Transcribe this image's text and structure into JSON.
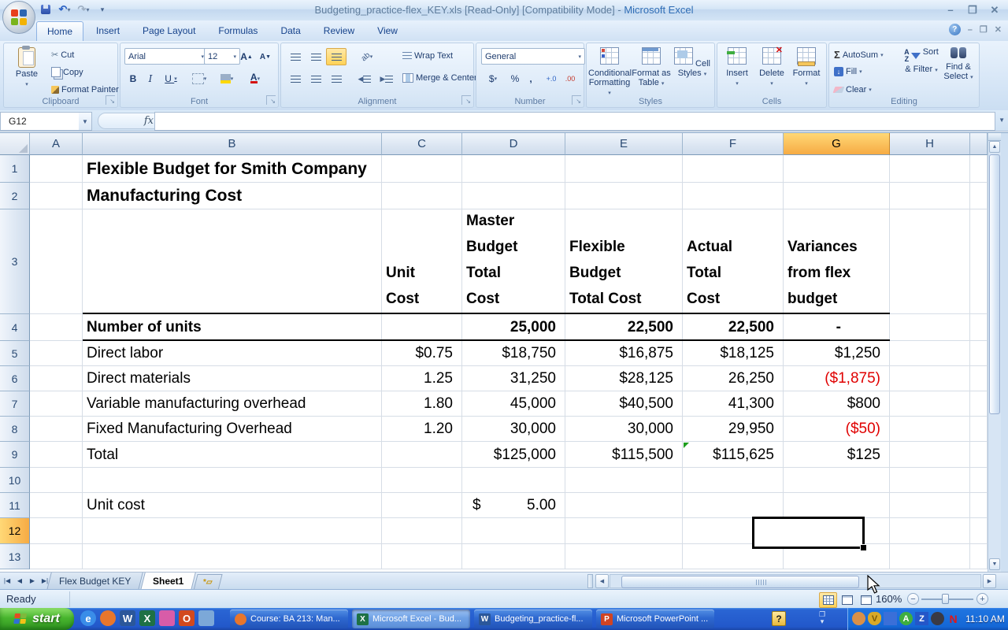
{
  "titlebar": {
    "doc_title": "Budgeting_practice-flex_KEY.xls  [Read-Only]  [Compatibility Mode] - ",
    "app_title": "Microsoft Excel"
  },
  "ribbon": {
    "active_tab": "Home",
    "tabs": [
      "Home",
      "Insert",
      "Page Layout",
      "Formulas",
      "Data",
      "Review",
      "View"
    ],
    "clipboard": {
      "label": "Clipboard",
      "paste": "Paste",
      "cut": "Cut",
      "copy": "Copy",
      "format_painter": "Format Painter"
    },
    "font": {
      "label": "Font",
      "name": "Arial",
      "size": "12",
      "bold": "B",
      "italic": "I",
      "underline": "U"
    },
    "alignment": {
      "label": "Alignment",
      "wrap": "Wrap Text",
      "merge": "Merge & Center"
    },
    "number": {
      "label": "Number",
      "format": "General",
      "currency": "$",
      "percent": "%",
      "comma": ",",
      "inc_dec": "+.0",
      "dec_dec": ".00"
    },
    "styles": {
      "label": "Styles",
      "conditional": "Conditional Formatting",
      "format_table": "Format as Table",
      "cell_styles": "Cell Styles"
    },
    "cells": {
      "label": "Cells",
      "insert": "Insert",
      "delete": "Delete",
      "format": "Format"
    },
    "editing": {
      "label": "Editing",
      "autosum": "AutoSum",
      "fill": "Fill",
      "clear": "Clear",
      "sort_filter": "Sort & Filter",
      "find_select": "Find & Select"
    }
  },
  "formula_bar": {
    "name_box": "G12",
    "fx_label": "fx",
    "formula": ""
  },
  "grid": {
    "col_headers": [
      "A",
      "B",
      "C",
      "D",
      "E",
      "F",
      "G",
      "H"
    ],
    "selected_col": "G",
    "selected_row": 12,
    "selected_cell": "G12",
    "accent_colors": {
      "selection_header": "#f6ab44",
      "negative_value": "#e00000",
      "flag_green": "#1e9e1e"
    },
    "rows": [
      {
        "n": 1,
        "cells": [
          {
            "col": "B",
            "text": "Flexible Budget for Smith Company",
            "bold": true,
            "overflow": true,
            "big": true
          }
        ]
      },
      {
        "n": 2,
        "cells": [
          {
            "col": "B",
            "text": "Manufacturing Cost",
            "bold": true,
            "overflow": true,
            "big": true
          }
        ]
      },
      {
        "n": 3,
        "cells": [
          {
            "col": "C",
            "text": "Unit\nCost",
            "bold": true,
            "multiline": true
          },
          {
            "col": "D",
            "text": "Master\nBudget\nTotal\nCost",
            "bold": true,
            "multiline": true
          },
          {
            "col": "E",
            "text": "Flexible\nBudget\nTotal Cost",
            "bold": true,
            "multiline": true
          },
          {
            "col": "F",
            "text": "Actual\nTotal\nCost",
            "bold": true,
            "multiline": true
          },
          {
            "col": "G",
            "text": "Variances\nfrom flex\nbudget",
            "bold": true,
            "multiline": true
          }
        ]
      },
      {
        "n": 4,
        "cells": [
          {
            "col": "B",
            "text": "Number of units",
            "bold": true
          },
          {
            "col": "D",
            "text": "25,000",
            "bold": true,
            "align": "right"
          },
          {
            "col": "E",
            "text": "22,500",
            "bold": true,
            "align": "right"
          },
          {
            "col": "F",
            "text": "22,500",
            "bold": true,
            "align": "right"
          },
          {
            "col": "G",
            "text": "-",
            "bold": true,
            "align": "right",
            "pad_right": 62
          }
        ]
      },
      {
        "n": 5,
        "cells": [
          {
            "col": "B",
            "text": "Direct labor"
          },
          {
            "col": "C",
            "text": "$0.75",
            "align": "right"
          },
          {
            "col": "D",
            "text": "$18,750",
            "align": "right"
          },
          {
            "col": "E",
            "text": "$16,875",
            "align": "right"
          },
          {
            "col": "F",
            "text": "$18,125",
            "align": "right"
          },
          {
            "col": "G",
            "text": "$1,250",
            "align": "right"
          }
        ]
      },
      {
        "n": 6,
        "cells": [
          {
            "col": "B",
            "text": "Direct materials"
          },
          {
            "col": "C",
            "text": "1.25",
            "align": "right"
          },
          {
            "col": "D",
            "text": "31,250",
            "align": "right"
          },
          {
            "col": "E",
            "text": "$28,125",
            "align": "right"
          },
          {
            "col": "F",
            "text": "26,250",
            "align": "right"
          },
          {
            "col": "G",
            "text": "($1,875)",
            "align": "right",
            "negative": true
          }
        ]
      },
      {
        "n": 7,
        "cells": [
          {
            "col": "B",
            "text": "Variable manufacturing overhead"
          },
          {
            "col": "C",
            "text": "1.80",
            "align": "right"
          },
          {
            "col": "D",
            "text": "45,000",
            "align": "right"
          },
          {
            "col": "E",
            "text": "$40,500",
            "align": "right"
          },
          {
            "col": "F",
            "text": "41,300",
            "align": "right"
          },
          {
            "col": "G",
            "text": "$800",
            "align": "right"
          }
        ]
      },
      {
        "n": 8,
        "cells": [
          {
            "col": "B",
            "text": "Fixed Manufacturing Overhead"
          },
          {
            "col": "C",
            "text": "1.20",
            "align": "right"
          },
          {
            "col": "D",
            "text": "30,000",
            "align": "right"
          },
          {
            "col": "E",
            "text": "30,000",
            "align": "right"
          },
          {
            "col": "F",
            "text": "29,950",
            "align": "right"
          },
          {
            "col": "G",
            "text": "($50)",
            "align": "right",
            "negative": true
          }
        ]
      },
      {
        "n": 9,
        "cells": [
          {
            "col": "B",
            "text": "Total"
          },
          {
            "col": "D",
            "text": "$125,000",
            "align": "right"
          },
          {
            "col": "E",
            "text": "$115,500",
            "align": "right"
          },
          {
            "col": "F",
            "text": "$115,625",
            "align": "right",
            "flag": true
          },
          {
            "col": "G",
            "text": "$125",
            "align": "right"
          }
        ]
      },
      {
        "n": 10,
        "cells": []
      },
      {
        "n": 11,
        "cells": [
          {
            "col": "B",
            "text": "Unit cost"
          },
          {
            "col": "D",
            "text": "5.00",
            "accounting_symbol": "$"
          }
        ]
      },
      {
        "n": 12,
        "cells": []
      },
      {
        "n": 13,
        "cells": []
      }
    ]
  },
  "sheet_tabs": {
    "tabs": [
      {
        "name": "Flex Budget KEY",
        "active": false
      },
      {
        "name": "Sheet1",
        "active": true
      }
    ]
  },
  "status_bar": {
    "mode": "Ready",
    "zoom": "160%"
  },
  "taskbar": {
    "start_label": "start",
    "quick_launch": [
      {
        "name": "internet-explorer-icon",
        "glyph": "e",
        "bg": "#3a8de8",
        "shape": "circle"
      },
      {
        "name": "firefox-icon",
        "glyph": "",
        "bg": "#e8762c",
        "shape": "circle"
      },
      {
        "name": "word-icon",
        "glyph": "W",
        "bg": "#2b579a",
        "shape": "square"
      },
      {
        "name": "excel-icon",
        "glyph": "X",
        "bg": "#1e7145",
        "shape": "square"
      },
      {
        "name": "pink-key-icon",
        "glyph": "",
        "bg": "#d85ca8",
        "shape": "square"
      },
      {
        "name": "outlook-icon",
        "glyph": "O",
        "bg": "#d2491e",
        "shape": "square"
      },
      {
        "name": "messenger-icon",
        "glyph": "",
        "bg": "#7ca8d8",
        "shape": "square"
      }
    ],
    "tasks": [
      {
        "label": "Course: BA 213: Man...",
        "icon": "firefox-icon",
        "icon_bg": "#e8762c",
        "icon_glyph": "",
        "active": false
      },
      {
        "label": "Microsoft Excel - Bud...",
        "icon": "excel-icon",
        "icon_bg": "#1e7145",
        "icon_glyph": "X",
        "active": true
      },
      {
        "label": "Budgeting_practice-fl...",
        "icon": "word-icon",
        "icon_bg": "#2b579a",
        "icon_glyph": "W",
        "active": false
      },
      {
        "label": "Microsoft PowerPoint ...",
        "icon": "powerpoint-icon",
        "icon_bg": "#d04423",
        "icon_glyph": "P",
        "active": false
      }
    ],
    "tray_help_glyph": "?",
    "tray_icons": [
      {
        "name": "orange-ball-icon",
        "glyph": "",
        "bg": "#d89048",
        "fg": "#fff",
        "shape": "circle"
      },
      {
        "name": "gold-shield-icon",
        "glyph": "V",
        "bg": "#d9a928",
        "fg": "#7a5a08",
        "shape": "shield"
      },
      {
        "name": "blue-tools-icon",
        "glyph": "",
        "bg": "#3a6fd8",
        "fg": "#fff",
        "shape": "square"
      },
      {
        "name": "green-a-icon",
        "glyph": "A",
        "bg": "#3fae3f",
        "fg": "#fff",
        "shape": "circle"
      },
      {
        "name": "blue-z-icon",
        "glyph": "Z",
        "bg": "#2456c8",
        "fg": "#fff",
        "shape": "square"
      },
      {
        "name": "dark-circle-icon",
        "glyph": "",
        "bg": "#3a3a44",
        "fg": "#fff",
        "shape": "circle"
      },
      {
        "name": "red-n-icon",
        "glyph": "N",
        "bg": "transparent",
        "fg": "#e01818",
        "shape": "letter"
      }
    ],
    "clock": "11:10 AM"
  }
}
